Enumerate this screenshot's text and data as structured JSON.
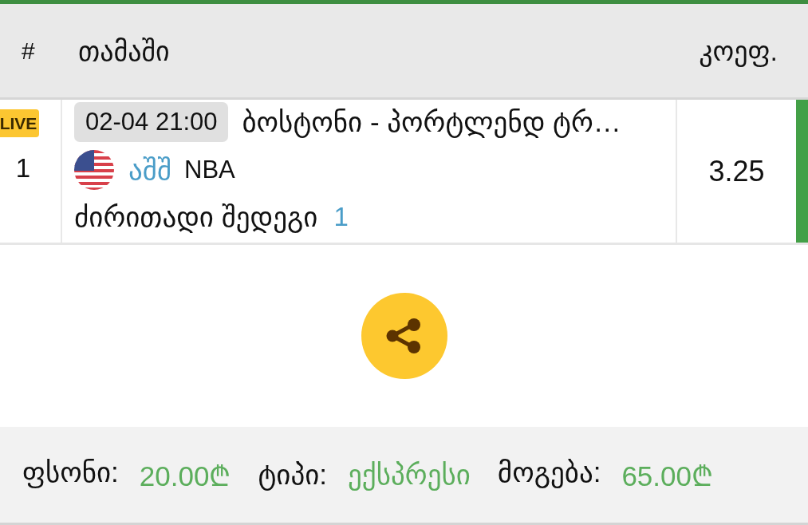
{
  "header": {
    "columns": [
      "#",
      "თამაში",
      "კოეფ."
    ]
  },
  "bets": [
    {
      "badge": "LIVE",
      "number": "1",
      "datetime": "02-04 21:00",
      "match": "ბოსტონი - პორტლენდ ტრ…",
      "country": "აშშ",
      "league": "NBA",
      "market": "ძირითადი შედეგი",
      "pick": "1",
      "odds": "3.25",
      "color": "#43a047"
    }
  ],
  "summary": [
    {
      "label": "ფსონი:",
      "value": "20.00₾"
    },
    {
      "label": "ტიპი:",
      "value": "ექსპრესი"
    },
    {
      "label": "მოგება:",
      "value": "65.00₾"
    }
  ]
}
